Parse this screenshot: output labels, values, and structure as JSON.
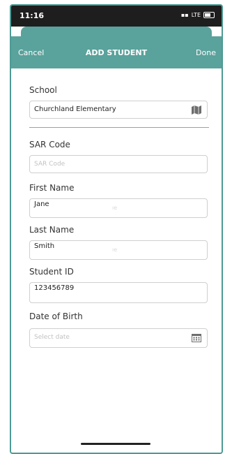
{
  "status": {
    "time": "11:16",
    "network": "LTE"
  },
  "nav": {
    "cancel": "Cancel",
    "title": "ADD STUDENT",
    "done": "Done"
  },
  "form": {
    "school": {
      "label": "School",
      "value": "Churchland Elementary"
    },
    "sar_code": {
      "label": "SAR Code",
      "placeholder": "SAR Code"
    },
    "first_name": {
      "label": "First Name",
      "value": "Jane",
      "ghost": "ıe"
    },
    "last_name": {
      "label": "Last Name",
      "value": "Smith",
      "ghost": "ıe"
    },
    "student_id": {
      "label": "Student ID",
      "value": "123456789"
    },
    "dob": {
      "label": "Date of Birth",
      "placeholder": "Select date"
    }
  },
  "colors": {
    "accent": "#5aa29c",
    "frame": "#4e9a94",
    "status_bar": "#1e1e1e"
  },
  "icons": {
    "school_picker": "map-icon",
    "date_picker": "calendar-icon"
  }
}
